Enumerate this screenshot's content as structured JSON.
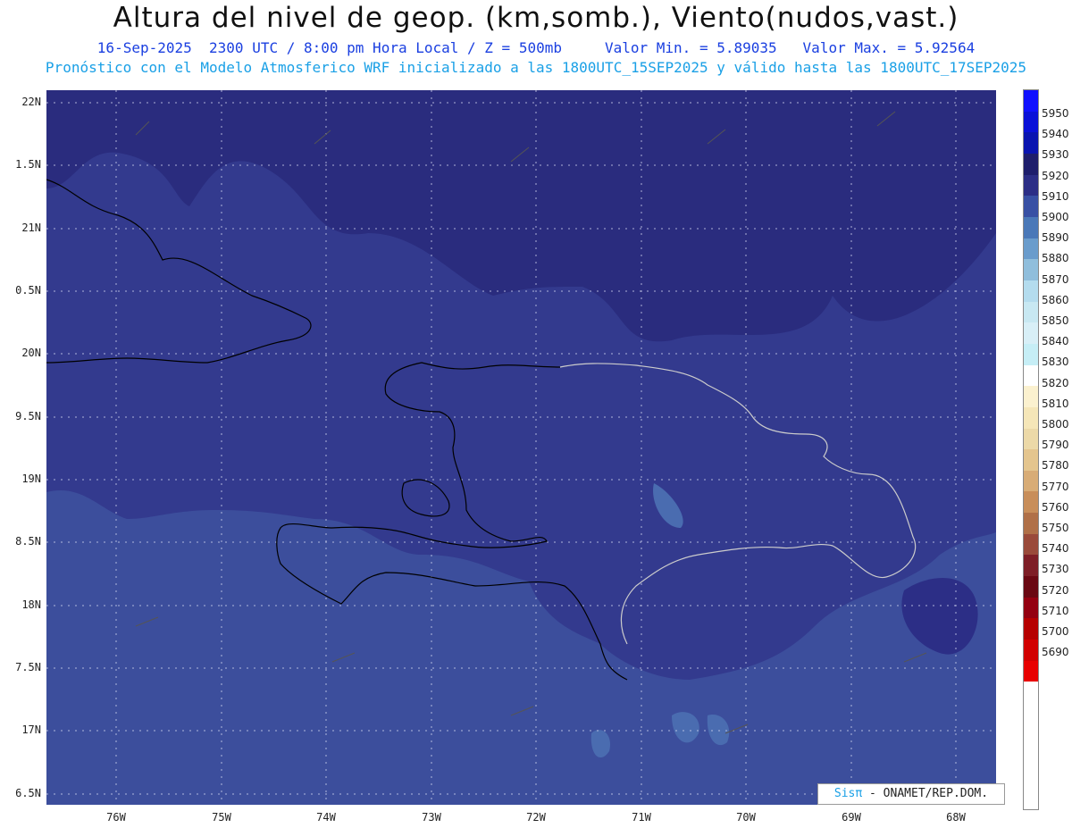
{
  "header": {
    "title": "Altura del nivel de geop. (km,somb.), Viento(nudos,vast.)",
    "date": "16-Sep-2025",
    "time": "2300 UTC / 8:00 pm Hora Local / Z = 500mb",
    "min": "Valor Min. = 5.89035",
    "max": "Valor Max. = 5.92564",
    "model": "Pronóstico con el Modelo Atmosferico WRF inicializado a las 1800UTC_15SEP2025 y válido hasta las  1800UTC_17SEP2025"
  },
  "lat_labels": [
    "22N",
    "1.5N",
    "21N",
    "0.5N",
    "20N",
    "9.5N",
    "19N",
    "8.5N",
    "18N",
    "7.5N",
    "17N",
    "6.5N"
  ],
  "lon_labels": [
    "76W",
    "75W",
    "74W",
    "73W",
    "72W",
    "71W",
    "70W",
    "69W",
    "68W"
  ],
  "colorbar": {
    "labels": [
      "5950",
      "5940",
      "5930",
      "5920",
      "5910",
      "5900",
      "5890",
      "5880",
      "5870",
      "5860",
      "5850",
      "5840",
      "5830",
      "5820",
      "5810",
      "5800",
      "5790",
      "5780",
      "5770",
      "5760",
      "5750",
      "5740",
      "5730",
      "5720",
      "5710",
      "5700",
      "5690"
    ],
    "colors": [
      "#1010ff",
      "#0a10d8",
      "#0a14b0",
      "#1e1e6c",
      "#2c2e86",
      "#3850a4",
      "#4a78b8",
      "#6a9ccc",
      "#90bedc",
      "#b4dcee",
      "#c8e8f2",
      "#d8eff7",
      "#c6eef6",
      "#ffffff",
      "#fbf1cf",
      "#f5e6b8",
      "#ecd9a8",
      "#e4c58e",
      "#d8ac76",
      "#c88e5a",
      "#b07048",
      "#9a4a3a",
      "#7e1e26",
      "#6a0812",
      "#940010",
      "#b60000",
      "#d20000",
      "#e80000"
    ]
  },
  "credit": {
    "brand": "Sisπ",
    "text": " - ONAMET/REP.DOM."
  },
  "colors": {
    "deep": "#2a2c7e",
    "mid": "#333a8e",
    "south": "#3c4e9c",
    "light": "#4a6cb0"
  }
}
